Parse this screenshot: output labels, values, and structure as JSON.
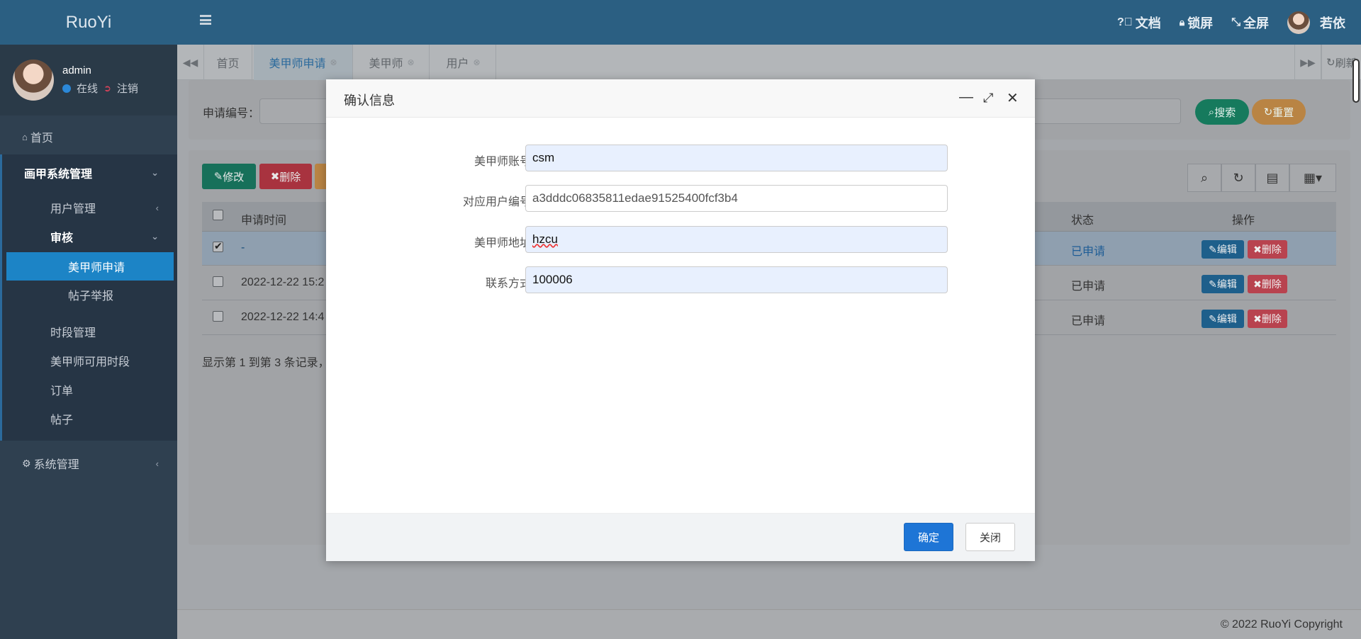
{
  "sidebar": {
    "logo": "RuoYi",
    "user": {
      "name": "admin",
      "status": "在线",
      "logout": "注销"
    },
    "home": "首页",
    "group": "画甲系统管理",
    "items": [
      "用户管理",
      "审核",
      "美甲师申请",
      "帖子举报",
      "时段管理",
      "美甲师可用时段",
      "订单",
      "帖子"
    ],
    "system": "系统管理"
  },
  "topbar": {
    "docs": "文档",
    "lock": "锁屏",
    "fullscreen": "全屏",
    "username": "若依"
  },
  "tabs": {
    "items": [
      "首页",
      "美甲师申请",
      "美甲师",
      "用户"
    ],
    "active": "美甲师申请",
    "refresh": "刷新"
  },
  "search": {
    "label": "申请编号：",
    "search_btn": "搜索",
    "reset_btn": "重置"
  },
  "toolbar": {
    "edit": "修改",
    "delete": "删除"
  },
  "table": {
    "headers": {
      "time": "申请时间",
      "status": "状态",
      "actions": "操作"
    },
    "rows": [
      {
        "time": "-",
        "status": "已申请",
        "checked": true
      },
      {
        "time": "2022-12-22 15:2",
        "status": "已申请",
        "checked": false
      },
      {
        "time": "2022-12-22 14:4",
        "status": "已申请",
        "checked": false
      }
    ],
    "edit_label": "编辑",
    "delete_label": "删除",
    "summary": "显示第 1 到第 3 条记录，"
  },
  "footer": "© 2022 RuoYi Copyright",
  "modal": {
    "title": "确认信息",
    "fields": [
      {
        "label": "美甲师账号：",
        "value": "csm"
      },
      {
        "label": "对应用户编号：",
        "value": "a3dddc06835811edae91525400fcf3b4"
      },
      {
        "label": "美甲师地址：",
        "value": "hzcu"
      },
      {
        "label": "联系方式：",
        "value": "100006"
      }
    ],
    "ok": "确定",
    "close": "关闭"
  },
  "colors": {
    "sidebar_bg": "#2f4050",
    "header_bg": "#2b5f82",
    "primary": "#1e75d6",
    "active_menu": "#1c84c6",
    "status_link": "#2b88d8"
  }
}
